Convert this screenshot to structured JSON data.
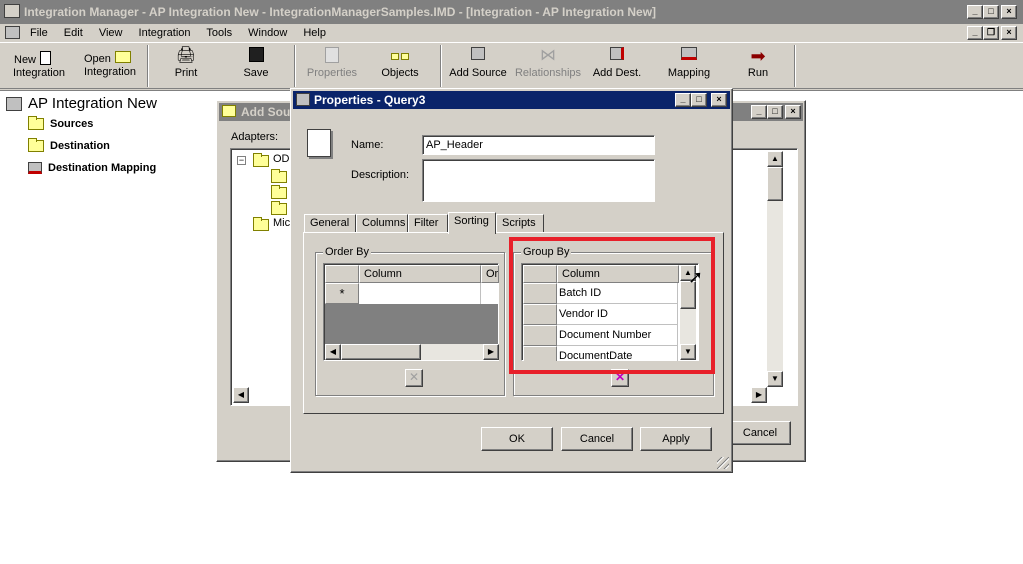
{
  "app": {
    "title": "Integration Manager - AP Integration New - IntegrationManagerSamples.IMD - [Integration - AP Integration New]"
  },
  "menu": [
    "File",
    "Edit",
    "View",
    "Integration",
    "Tools",
    "Window",
    "Help"
  ],
  "toolbar": {
    "new_label_1": "New",
    "new_label_2": "Integration",
    "open_label_1": "Open",
    "open_label_2": "Integration",
    "print": "Print",
    "save": "Save",
    "properties": "Properties",
    "objects": "Objects",
    "add_source": "Add Source",
    "relationships": "Relationships",
    "add_dest": "Add Dest.",
    "mapping": "Mapping",
    "run": "Run"
  },
  "tree": {
    "title": "AP Integration New",
    "items": [
      "Sources",
      "Destination",
      "Destination Mapping"
    ]
  },
  "add_source": {
    "title": "Add Sou",
    "adapters_label": "Adapters:",
    "items": [
      "ODE",
      "Micr"
    ],
    "cancel": "Cancel"
  },
  "properties": {
    "title": "Properties - Query3",
    "name_label": "Name:",
    "name_value": "AP_Header",
    "description_label": "Description:",
    "description_value": "",
    "tabs": [
      "General",
      "Columns",
      "Filter",
      "Sorting",
      "Scripts"
    ],
    "active_tab": "Sorting",
    "order_by": {
      "label": "Order By",
      "col1": "Column",
      "col2": "Orde",
      "new_row_marker": "*"
    },
    "group_by": {
      "label": "Group By",
      "col1": "Column",
      "rows": [
        "Batch ID",
        "Vendor ID",
        "Document Number",
        "DocumentDate"
      ]
    },
    "ok": "OK",
    "cancel": "Cancel",
    "apply": "Apply"
  },
  "colors": {
    "highlight": "#e8202a",
    "active_title": "#0a246a",
    "inactive_title": "#808080"
  }
}
